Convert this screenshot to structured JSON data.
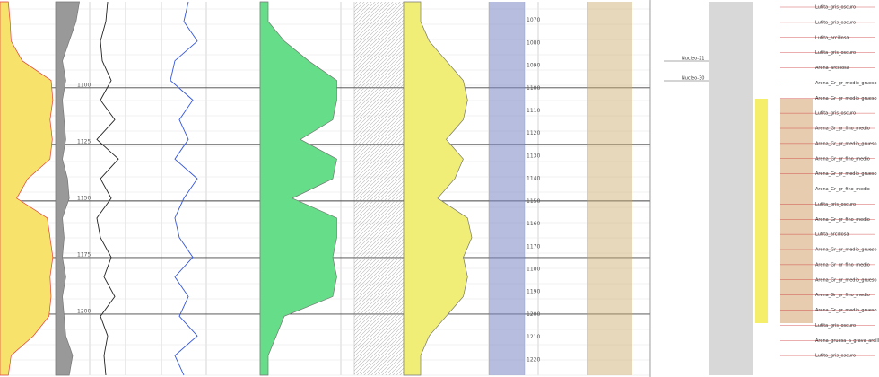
{
  "chart_data": [
    {
      "type": "area",
      "panel": "well-log-left",
      "depth_axis": {
        "ticks": [
          "1100",
          "1125",
          "1150",
          "1175",
          "1200"
        ],
        "range": [
          1062,
          1227
        ]
      },
      "tracks": [
        {
          "name": "",
          "fill": "#f7e26b",
          "curve": "#e04040",
          "values": [
            0.15,
            0.18,
            0.2,
            0.4,
            0.92,
            0.95,
            0.9,
            0.94,
            0.9,
            0.5,
            0.3,
            0.85,
            0.9,
            0.95,
            0.9,
            0.92,
            0.88,
            0.6,
            0.2,
            0.15
          ]
        },
        {
          "name": "",
          "fill": "#999999",
          "values": [
            0.7,
            0.6,
            0.4,
            0.2,
            0.3,
            0.2,
            0.25,
            0.3,
            0.2,
            0.35,
            0.4,
            0.2,
            0.25,
            0.2,
            0.3,
            0.2,
            0.25,
            0.3,
            0.5,
            0.4
          ]
        },
        {
          "name": "",
          "curve": "#222222",
          "values": [
            0.5,
            0.45,
            0.3,
            0.35,
            0.6,
            0.3,
            0.7,
            0.2,
            0.8,
            0.3,
            0.6,
            0.2,
            0.3,
            0.6,
            0.4,
            0.7,
            0.3,
            0.5,
            0.4,
            0.45
          ]
        },
        {
          "name": "",
          "curve": "#3355dd",
          "values": [
            0.6,
            0.5,
            0.8,
            0.3,
            0.2,
            0.7,
            0.4,
            0.6,
            0.3,
            0.8,
            0.5,
            0.3,
            0.4,
            0.7,
            0.3,
            0.6,
            0.4,
            0.8,
            0.3,
            0.5
          ]
        },
        {
          "name": "",
          "fill": "#66dd88",
          "values": [
            0.1,
            0.1,
            0.3,
            0.6,
            0.95,
            0.95,
            0.9,
            0.5,
            0.95,
            0.9,
            0.4,
            0.95,
            0.95,
            0.9,
            0.95,
            0.9,
            0.3,
            0.2,
            0.1,
            0.1
          ]
        },
        {
          "name": "",
          "fill": "#f0ee77",
          "values": [
            0.2,
            0.2,
            0.3,
            0.5,
            0.7,
            0.75,
            0.7,
            0.5,
            0.7,
            0.6,
            0.4,
            0.75,
            0.8,
            0.7,
            0.75,
            0.7,
            0.5,
            0.3,
            0.2,
            0.2
          ]
        }
      ],
      "depth_markers": [
        "1070",
        "1080",
        "1090",
        "1100",
        "1110",
        "1120",
        "1130",
        "1140",
        "1150",
        "1160",
        "1170",
        "1180",
        "1190",
        "1200",
        "1210",
        "1220"
      ]
    },
    {
      "type": "area",
      "panel": "lithology-right",
      "labels": [
        "Lutita_gris_oscuro",
        "Lutita_gris_oscuro",
        "Lutita_arcillosa",
        "Lutita_gris_oscuro",
        "Arena_arcillosa",
        "Arena_Gr_gr_medio_grueso",
        "Arena_Gr_gr_medio_grueso",
        "Lutita_gris_oscuro",
        "Arena_Gr_gr_fino_medio",
        "Arena_Gr_gr_medio_grueso",
        "Arena_Gr_gr_fino_medio",
        "Arena_Gr_gr_medio_grueso",
        "Arena_Gr_gr_fino_medio",
        "Lutita_gris_oscuro",
        "Arena_Gr_gr_fino_medio",
        "Lutita_arcillosa",
        "Arena_Gr_gr_medio_grueso",
        "Arena_Gr_gr_fino_medio",
        "Arena_Gr_gr_medio_grueso",
        "Arena_Gr_gr_fino_medio",
        "Arena_Gr_gr_medio_grueso",
        "Lutita_gris_oscuro",
        "Arena_gruesa_a_grava_arcillosa",
        "Lutita_gris_oscuro"
      ],
      "annotations": [
        "Nucleo-21",
        "Nucleo-30"
      ]
    }
  ]
}
